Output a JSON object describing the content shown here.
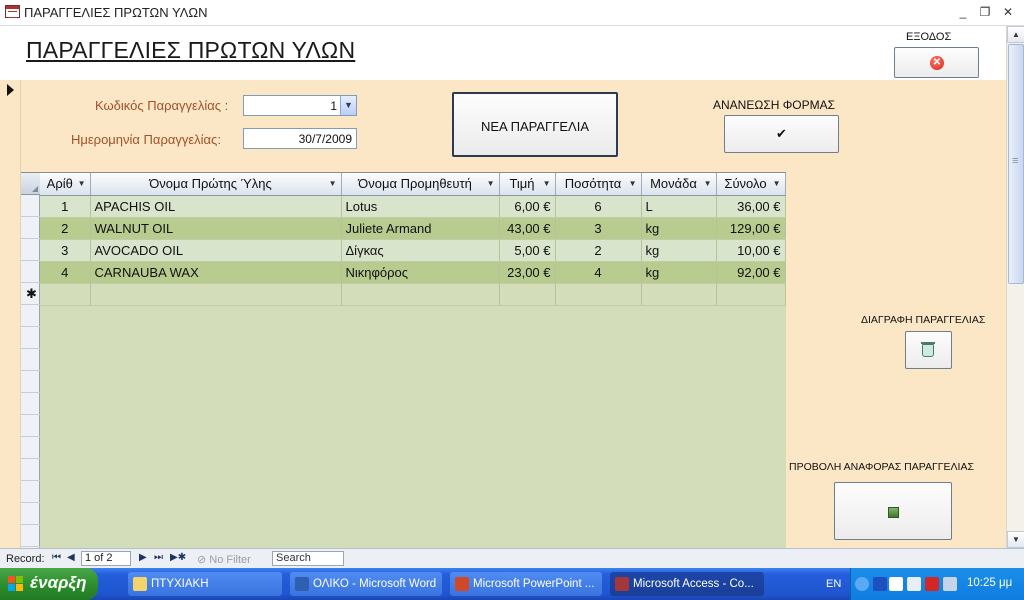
{
  "window": {
    "title": "ΠΑΡΑΓΓΕΛΙΕΣ ΠΡΩΤΩΝ ΥΛΩΝ",
    "minimize": "_",
    "restore": "❐",
    "close": "✕"
  },
  "form": {
    "title": "ΠΑΡΑΓΓΕΛΙΕΣ ΠΡΩΤΩΝ ΥΛΩΝ",
    "exit_label": "ΕΞΟΔΟΣ",
    "exit_icon": "✕",
    "order_code_label": "Κωδικός Παραγγελίας :",
    "order_code_value": "1",
    "order_date_label": "Ημερομηνία Παραγγελίας:",
    "order_date_value": "30/7/2009",
    "new_order_button": "ΝΕΑ ΠΑΡΑΓΓΕΛΙΑ",
    "refresh_label": "ΑΝΑΝΕΩΣΗ ΦΟΡΜΑΣ",
    "refresh_icon": "✔",
    "delete_label": "ΔΙΑΓΡΑΦΗ ΠΑΡΑΓΓΕΛΙΑΣ",
    "report_label": "ΠΡΟΒΟΛΗ ΑΝΑΦΟΡΑΣ ΠΑΡΑΓΓΕΛΙΑΣ",
    "combo_arrow": "▼"
  },
  "datasheet": {
    "columns": [
      "Αρίθ",
      "Όνομα Πρώτης Ύλης",
      "Όνομα Προμηθευτή",
      "Τιμή",
      "Ποσότητα",
      "Μονάδα",
      "Σύνολο"
    ],
    "sort_arrow": "▼",
    "new_row_marker": "✱",
    "rows": [
      [
        "1",
        "APACHIS OIL",
        "Lotus",
        "6,00 €",
        "6",
        "L",
        "36,00 €"
      ],
      [
        "2",
        "WALNUT OIL",
        "Juliete Armand",
        "43,00 €",
        "3",
        "kg",
        "129,00 €"
      ],
      [
        "3",
        "AVOCADO OIL",
        "Δίγκας",
        "5,00 €",
        "2",
        "kg",
        "10,00 €"
      ],
      [
        "4",
        "CARNAUBA WAX",
        "Νικηφόρος",
        "23,00 €",
        "4",
        "kg",
        "92,00 €"
      ]
    ]
  },
  "navigation": {
    "record_label": "Record:",
    "first": "⏮",
    "prev": "◀",
    "position": "1 of 2",
    "next": "▶",
    "last": "⏭",
    "new": "▶✱",
    "filter": "No Filter",
    "search": "Search"
  },
  "taskbar": {
    "start_label": "έναρξη",
    "tasks": [
      "ΠΤΥΧΙΑΚΗ",
      "ΟΛΙΚΟ - Microsoft Word",
      "Microsoft PowerPoint ...",
      "Microsoft Access - Co..."
    ],
    "language": "EN",
    "clock": "10:25 μμ"
  }
}
